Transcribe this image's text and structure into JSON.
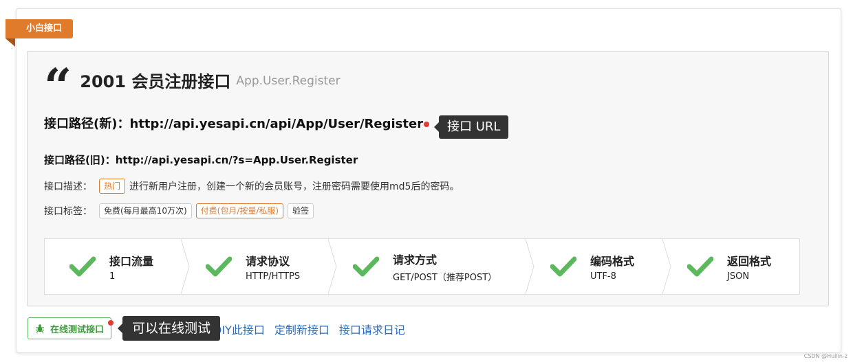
{
  "ribbon": "小白接口",
  "header": {
    "quote_glyph": "“",
    "title": "2001 会员注册接口",
    "subtitle": "App.User.Register"
  },
  "url_new": {
    "label": "接口路径(新)：",
    "value": "http://api.yesapi.cn/api/App/User/Register",
    "tooltip": "接口 URL"
  },
  "url_old": {
    "label": "接口路径(旧)：",
    "value": "http://api.yesapi.cn/?s=App.User.Register"
  },
  "description": {
    "label": "接口描述：",
    "tag": "热门",
    "text": "进行新用户注册，创建一个新的会员账号，注册密码需要使用md5后的密码。"
  },
  "tags": {
    "label": "接口标签：",
    "items": [
      "免费(每月最高10万次)",
      "付费(包月/按量/私服)",
      "验签"
    ]
  },
  "steps": [
    {
      "title": "接口流量",
      "value": "1"
    },
    {
      "title": "请求协议",
      "value": "HTTP/HTTPS"
    },
    {
      "title": "请求方式",
      "value": "GET/POST（推荐POST）"
    },
    {
      "title": "编码格式",
      "value": "UTF-8"
    },
    {
      "title": "返回格式",
      "value": "JSON"
    }
  ],
  "footer": {
    "test_button": "在线测试接口",
    "tooltip": "可以在线测试",
    "links": [
      "DIY此接口",
      "定制新接口",
      "接口请求日记"
    ]
  },
  "watermark": "CSDN @Huilin-z",
  "colors": {
    "accent_orange": "#e07b2c",
    "check_green": "#5cb85c",
    "link_blue": "#2d6bb4",
    "tooltip_bg": "#333333"
  },
  "icons": {
    "step": "check-icon",
    "test_button": "bug-icon"
  }
}
